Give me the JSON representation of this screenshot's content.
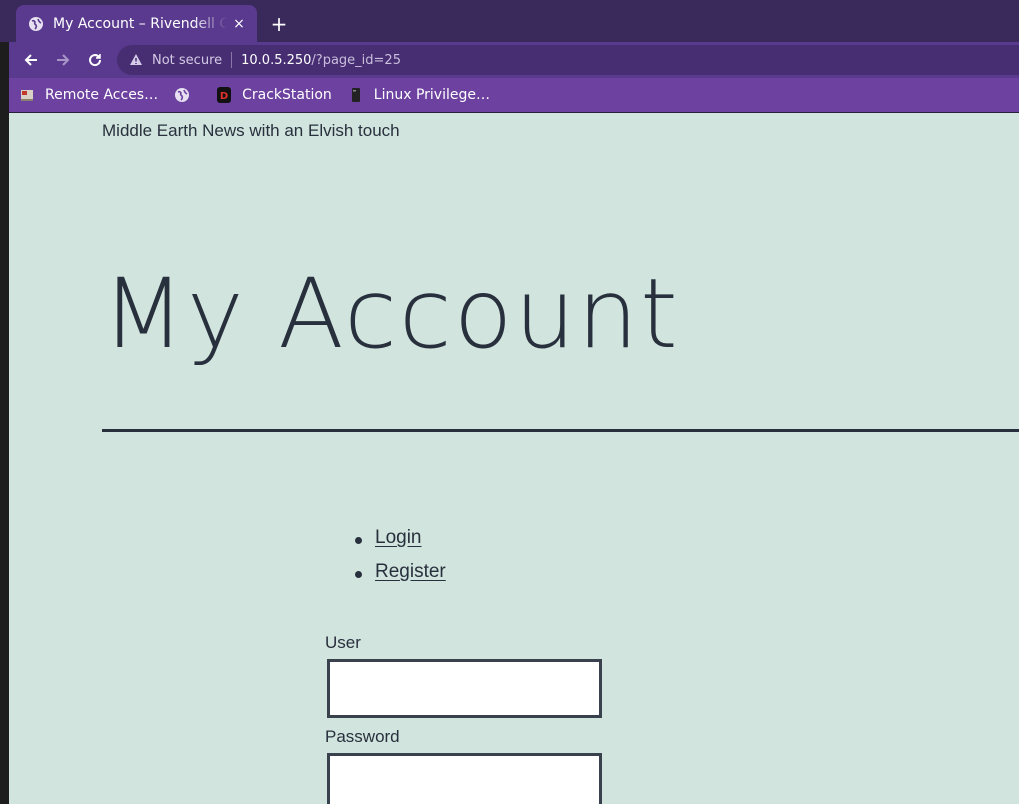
{
  "browser": {
    "tab": {
      "title": "My Account – Rivendell Co",
      "close": "×"
    },
    "new_tab": "+",
    "nav": {
      "back": "←",
      "forward": "→",
      "reload": "↻"
    },
    "omnibox": {
      "security_label": "Not secure",
      "url_host": "10.0.5.250",
      "url_path": "/?page_id=25"
    },
    "bookmarks": [
      {
        "label": "Remote Acces…",
        "icon": "remote-desktop-icon"
      },
      {
        "label": "",
        "icon": "globe-icon"
      },
      {
        "label": "CrackStation",
        "icon": "crackstation-icon"
      },
      {
        "label": "Linux Privilege…",
        "icon": "book-icon"
      }
    ]
  },
  "page": {
    "tagline": "Middle Earth News with an Elvish touch",
    "title": "My Account",
    "links": [
      "Login",
      "Register"
    ],
    "form": {
      "user_label": "User",
      "password_label": "Password",
      "user_value": "",
      "password_value": ""
    }
  },
  "colors": {
    "page_bg": "#d1e4dd",
    "text": "#28303d",
    "tab_bar": "#3a2a5c",
    "toolbar": "#5a3a8e",
    "bookmarks_bar": "#6c41a0"
  }
}
